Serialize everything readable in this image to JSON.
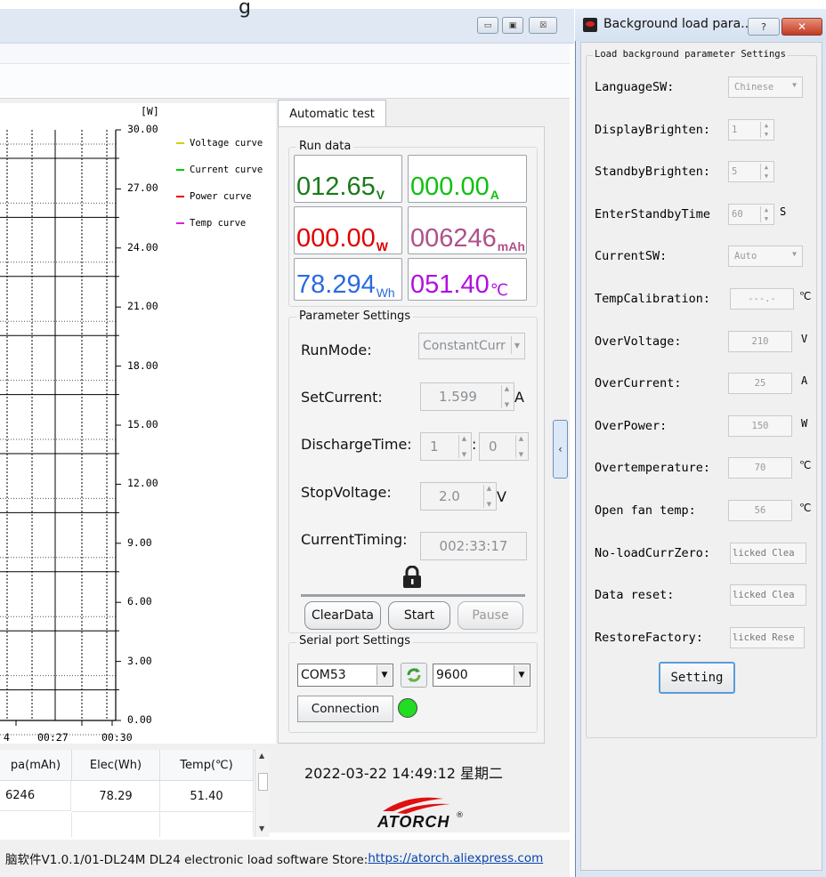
{
  "main_window": {
    "title_partial": "g",
    "controls": {
      "minimize": "▭",
      "maximize": "▣",
      "close": "☒"
    }
  },
  "chart_data": {
    "type": "line",
    "ylabel": "[W]",
    "ylim": [
      0,
      30
    ],
    "y_ticks": [
      "30.00",
      "27.00",
      "24.00",
      "21.00",
      "18.00",
      "15.00",
      "12.00",
      "9.00",
      "6.00",
      "3.00",
      "0.00"
    ],
    "x_ticks": [
      "4",
      "00:27",
      "00:30"
    ],
    "grid": true,
    "legend_position": "right",
    "series": [
      {
        "name": "Voltage curve",
        "color": "#d4d000",
        "values": []
      },
      {
        "name": "Current curve",
        "color": "#00cc00",
        "values": []
      },
      {
        "name": "Power curve",
        "color": "#e00000",
        "values": []
      },
      {
        "name": "Temp curve",
        "color": "#e020e0",
        "values": []
      }
    ]
  },
  "table": {
    "headers": [
      "pa(mAh)",
      "Elec(Wh)",
      "Temp(℃)"
    ],
    "rows": [
      [
        "6246",
        "78.29",
        "51.40"
      ]
    ]
  },
  "auto_test": {
    "tab_label": "Automatic test",
    "run_data": {
      "title": "Run data",
      "voltage": {
        "value": "012.65",
        "unit": "V",
        "color": "#1a7a1a"
      },
      "current": {
        "value": "000.00",
        "unit": "A",
        "color": "#10c010"
      },
      "power": {
        "value": "000.00",
        "unit": "W",
        "color": "#e00000"
      },
      "capacity": {
        "value": "006246",
        "unit": "mAh",
        "color": "#b0508a"
      },
      "energy": {
        "value": "78.294",
        "unit": "Wh",
        "color": "#2a6ae0"
      },
      "temp": {
        "value": "051.40",
        "unit": "℃",
        "color": "#b010e0"
      }
    },
    "params": {
      "title": "Parameter Settings",
      "run_mode_label": "RunMode:",
      "run_mode_value": "ConstantCurr",
      "set_current_label": "SetCurrent:",
      "set_current_value": "1.599",
      "set_current_unit": "A",
      "discharge_label": "DischargeTime:",
      "discharge_h": "1",
      "discharge_m": "0",
      "discharge_sep": ":",
      "stop_voltage_label": "StopVoltage:",
      "stop_voltage_value": "2.0",
      "stop_voltage_unit": "V",
      "timing_label": "CurrentTiming:",
      "timing_value": "002:33:17",
      "lock_icon": "lock-icon",
      "clear_btn": "ClearData",
      "start_btn": "Start",
      "pause_btn": "Pause"
    },
    "serial": {
      "title": "Serial port Settings",
      "port": "COM53",
      "baud": "9600",
      "connect_btn": "Connection",
      "status_color": "#22dd22"
    }
  },
  "datetime": "2022-03-22 14:49:12 星期二",
  "logo_text": "ATORCH",
  "logo_reg": "®",
  "status": {
    "text": "脑软件V1.0.1/01-DL24M DL24 electronic load software  Store:",
    "link": "https://atorch.aliexpress.com"
  },
  "dialog": {
    "title": "Background load para...",
    "help_btn": "?",
    "close_btn": "✕",
    "group_title": "Load background parameter Settings",
    "rows": [
      {
        "label": "LanguageSW:",
        "value": "Chinese",
        "unit": ""
      },
      {
        "label": "DisplayBrighten:",
        "value": "1",
        "unit": ""
      },
      {
        "label": "StandbyBrighten:",
        "value": "5",
        "unit": ""
      },
      {
        "label": "EnterStandbyTime",
        "value": "60",
        "unit": "S"
      },
      {
        "label": "CurrentSW:",
        "value": "Auto",
        "unit": ""
      },
      {
        "label": "TempCalibration:",
        "value": "---.-",
        "unit": "℃"
      },
      {
        "label": "OverVoltage:",
        "value": "210",
        "unit": "V"
      },
      {
        "label": "OverCurrent:",
        "value": "25",
        "unit": "A"
      },
      {
        "label": "OverPower:",
        "value": "150",
        "unit": "W"
      },
      {
        "label": "Overtemperature:",
        "value": "70",
        "unit": "℃"
      },
      {
        "label": "Open fan temp:",
        "value": "56",
        "unit": "℃"
      },
      {
        "label": "No-loadCurrZero:",
        "value": "licked Clea",
        "unit": ""
      },
      {
        "label": "Data reset:",
        "value": "licked Clea",
        "unit": ""
      },
      {
        "label": "RestoreFactory:",
        "value": "licked Rese",
        "unit": ""
      }
    ],
    "setting_btn": "Setting"
  }
}
